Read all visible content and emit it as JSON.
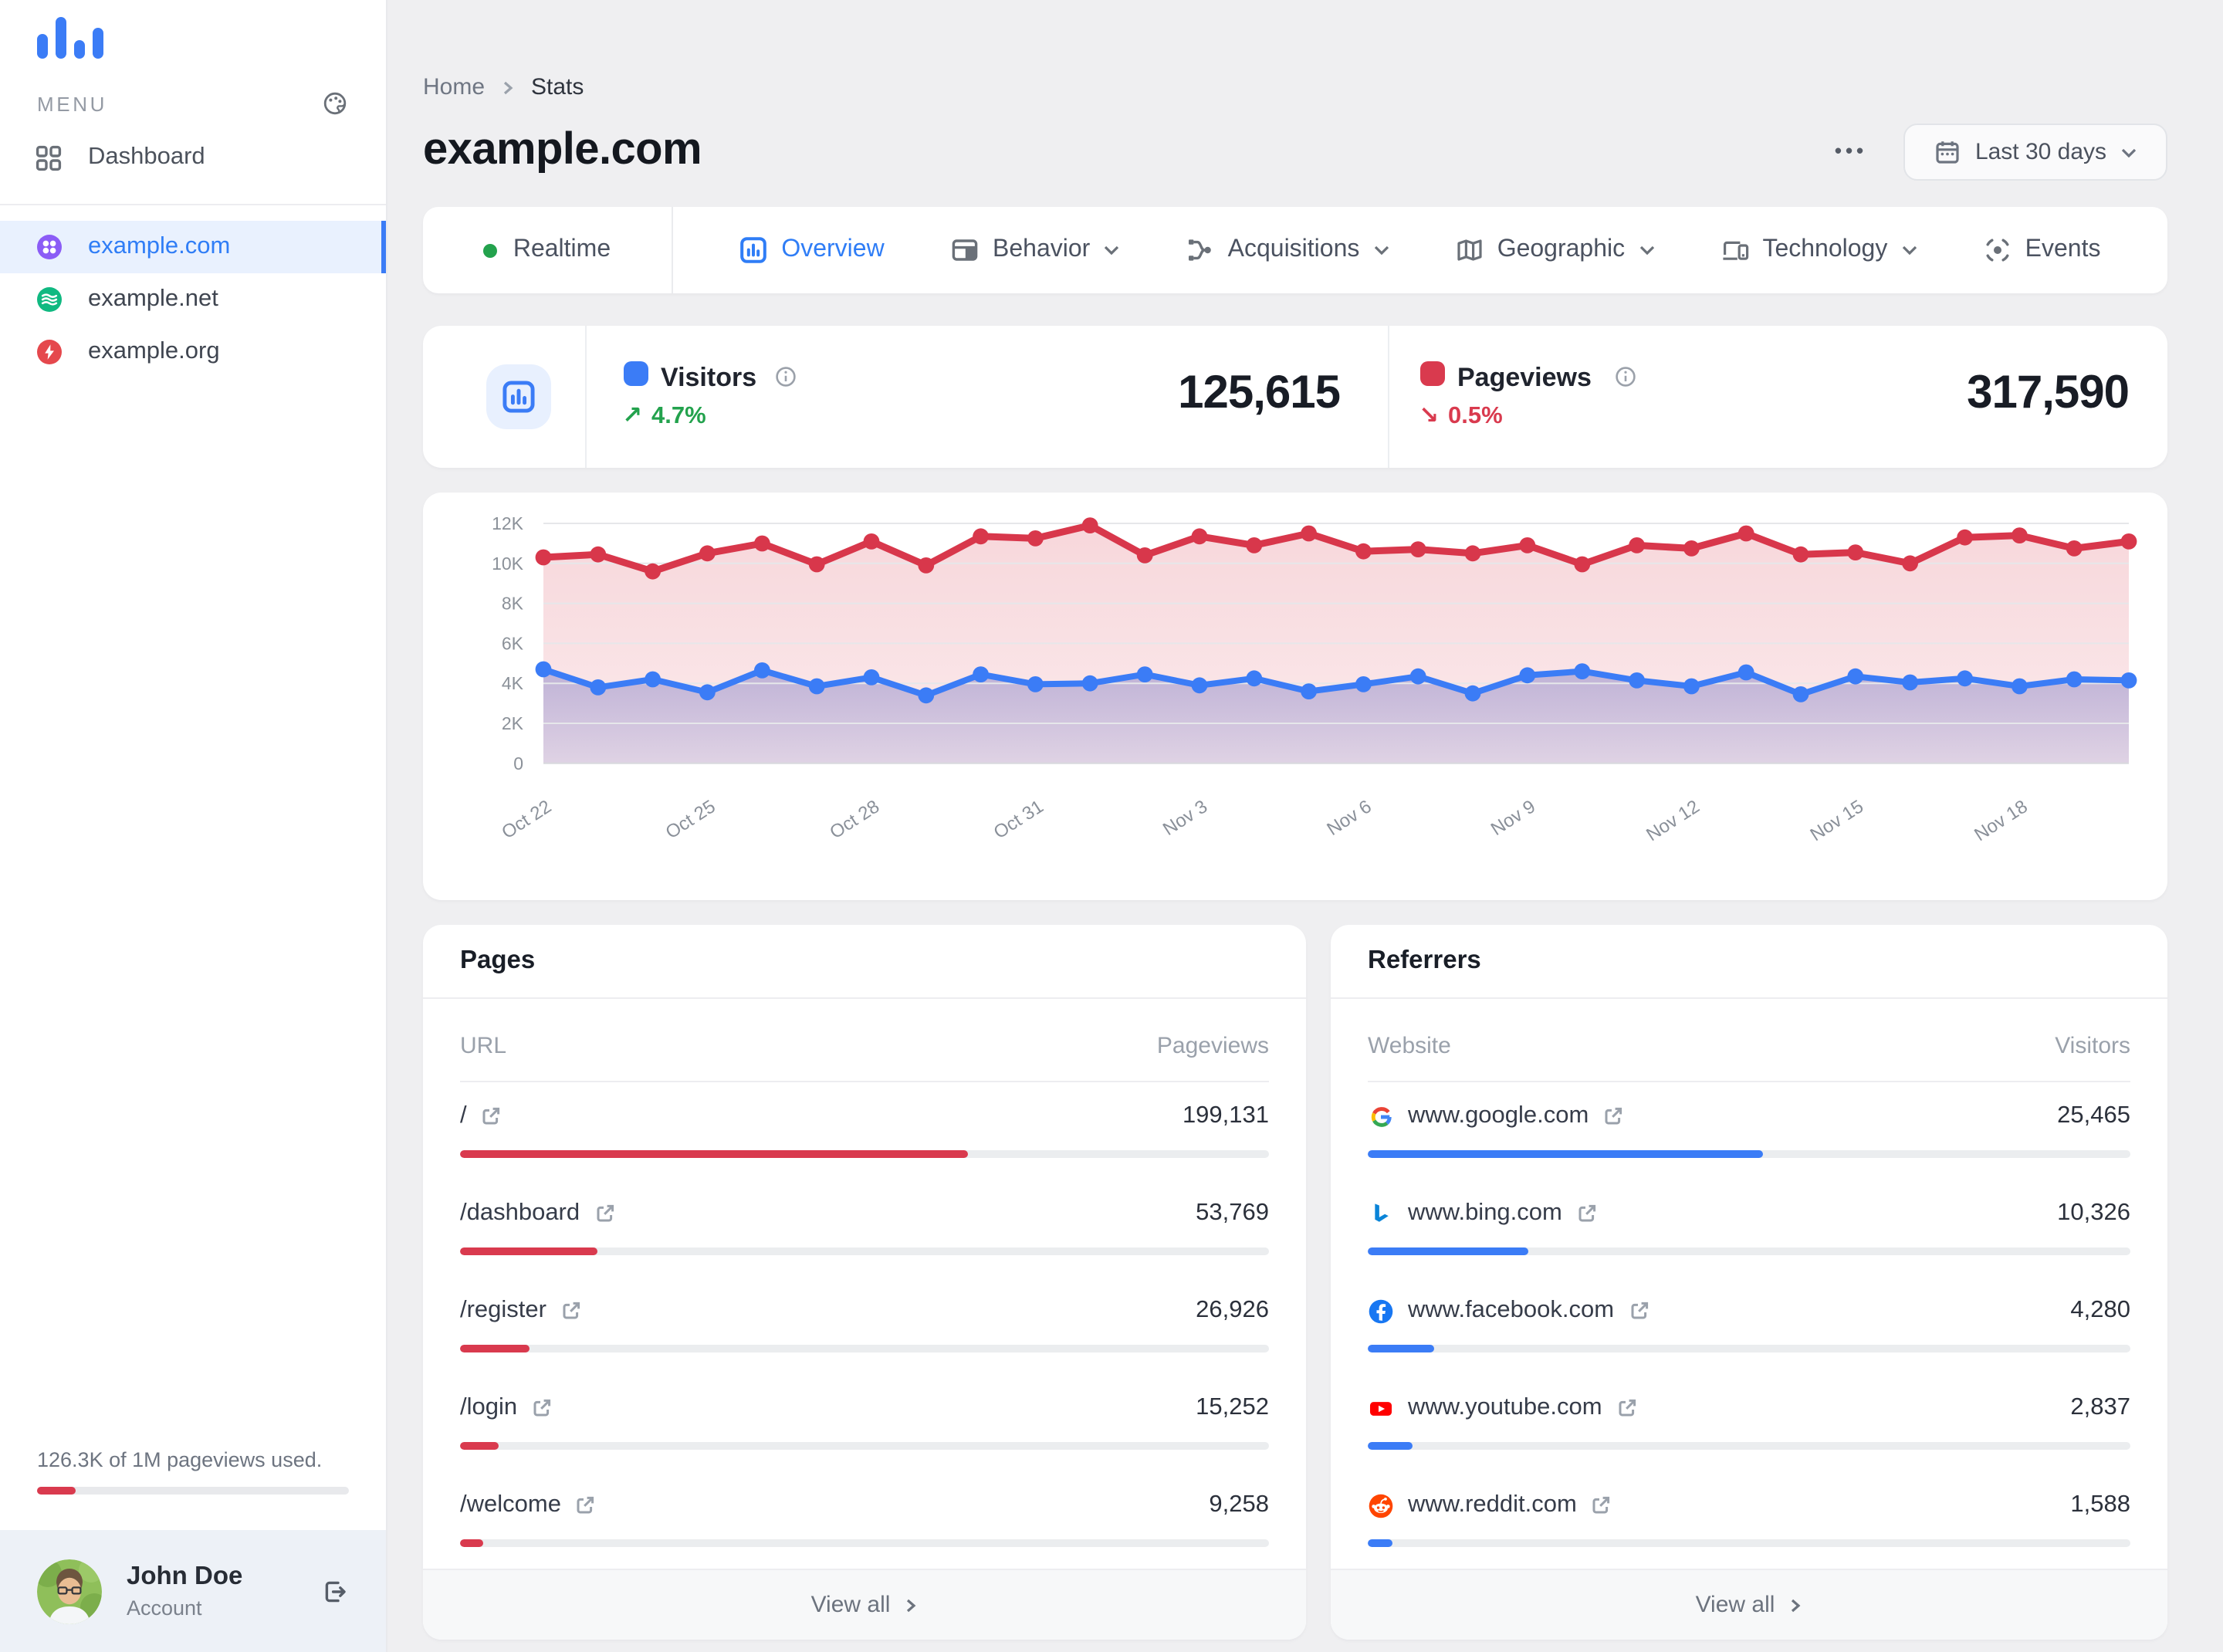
{
  "app": {
    "background": "#efeff1",
    "accent_blue": "#2f7df6",
    "accent_red": "#d93a4e",
    "accent_green": "#23a24d"
  },
  "sidebar": {
    "menu_label": "MENU",
    "dashboard_label": "Dashboard",
    "sites": [
      {
        "label": "example.com",
        "active": true,
        "icon": "clover-site-icon",
        "color": "#8b5cf6"
      },
      {
        "label": "example.net",
        "active": false,
        "icon": "waves-site-icon",
        "color": "#10b981"
      },
      {
        "label": "example.org",
        "active": false,
        "icon": "bolt-site-icon",
        "color": "#e5484d"
      }
    ],
    "usage": {
      "text": "126.3K of 1M pageviews used.",
      "pct": 12.6
    },
    "user": {
      "name": "John Doe",
      "role": "Account"
    }
  },
  "header": {
    "breadcrumb": {
      "home": "Home",
      "current": "Stats"
    },
    "title": "example.com",
    "more": "•••",
    "date_range": "Last 30 days"
  },
  "tabs": [
    {
      "label": "Realtime",
      "icon": "live-dot"
    },
    {
      "label": "Overview",
      "icon": "overview-icon",
      "active": true
    },
    {
      "label": "Behavior",
      "icon": "behavior-icon",
      "caret": true
    },
    {
      "label": "Acquisitions",
      "icon": "acquisitions-icon",
      "caret": true
    },
    {
      "label": "Geographic",
      "icon": "geographic-icon",
      "caret": true
    },
    {
      "label": "Technology",
      "icon": "technology-icon",
      "caret": true
    },
    {
      "label": "Events",
      "icon": "events-icon"
    }
  ],
  "kpis": {
    "visitors": {
      "label": "Visitors",
      "value": "125,615",
      "delta": "4.7%",
      "arrow": "↗",
      "trend": "up",
      "color": "#3b7cf6"
    },
    "pageviews": {
      "label": "Pageviews",
      "value": "317,590",
      "delta": "0.5%",
      "arrow": "↘",
      "trend": "down",
      "color": "#d93a4e"
    }
  },
  "chart_data": {
    "type": "area",
    "title": "",
    "xlabel": "",
    "ylabel": "",
    "ylim": [
      0,
      12000
    ],
    "grid": true,
    "legend": "none",
    "x_tick_labels": [
      "Oct 22",
      "Oct 25",
      "Oct 28",
      "Oct 31",
      "Nov 3",
      "Nov 6",
      "Nov 9",
      "Nov 12",
      "Nov 15",
      "Nov 18"
    ],
    "x_tick_indices": [
      0,
      3,
      6,
      9,
      12,
      15,
      18,
      21,
      24,
      27
    ],
    "y_ticks": [
      {
        "value": 0,
        "label": "0"
      },
      {
        "value": 2000,
        "label": "2K"
      },
      {
        "value": 4000,
        "label": "4K"
      },
      {
        "value": 6000,
        "label": "6K"
      },
      {
        "value": 8000,
        "label": "8K"
      },
      {
        "value": 10000,
        "label": "10K"
      },
      {
        "value": 12000,
        "label": "12K"
      }
    ],
    "series": [
      {
        "name": "Pageviews",
        "color": "#d8374b",
        "values": [
          10300,
          10450,
          9600,
          10500,
          11000,
          9950,
          11100,
          9900,
          11350,
          11250,
          11900,
          10400,
          11350,
          10900,
          11500,
          10600,
          10700,
          10500,
          10900,
          9950,
          10900,
          10750,
          11500,
          10450,
          10550,
          10000,
          11300,
          11400,
          10750,
          11100
        ]
      },
      {
        "name": "Visitors",
        "color": "#3b7cf6",
        "values": [
          4700,
          3800,
          4200,
          3550,
          4650,
          3850,
          4300,
          3400,
          4450,
          3950,
          4000,
          4450,
          3900,
          4250,
          3600,
          3950,
          4350,
          3500,
          4400,
          4600,
          4150,
          3850,
          4550,
          3450,
          4350,
          4050,
          4250,
          3850,
          4200,
          4150
        ]
      }
    ]
  },
  "pages": {
    "title": "Pages",
    "col_label": "URL",
    "col_value": "Pageviews",
    "view_all": "View all",
    "rows": [
      {
        "url": "/",
        "value": "199,131",
        "pct": 62.7
      },
      {
        "url": "/dashboard",
        "value": "53,769",
        "pct": 16.9
      },
      {
        "url": "/register",
        "value": "26,926",
        "pct": 8.5
      },
      {
        "url": "/login",
        "value": "15,252",
        "pct": 4.8
      },
      {
        "url": "/welcome",
        "value": "9,258",
        "pct": 2.9
      }
    ]
  },
  "referrers": {
    "title": "Referrers",
    "col_label": "Website",
    "col_value": "Visitors",
    "view_all": "View all",
    "rows": [
      {
        "site": "www.google.com",
        "value": "25,465",
        "pct": 51.8,
        "icon": "google-favicon"
      },
      {
        "site": "www.bing.com",
        "value": "10,326",
        "pct": 21.0,
        "icon": "bing-favicon"
      },
      {
        "site": "www.facebook.com",
        "value": "4,280",
        "pct": 8.7,
        "icon": "facebook-favicon"
      },
      {
        "site": "www.youtube.com",
        "value": "2,837",
        "pct": 5.8,
        "icon": "youtube-favicon"
      },
      {
        "site": "www.reddit.com",
        "value": "1,588",
        "pct": 3.2,
        "icon": "reddit-favicon"
      }
    ]
  }
}
